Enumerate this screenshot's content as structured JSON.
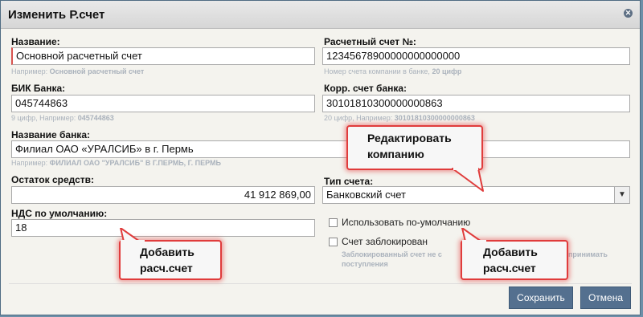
{
  "dialog": {
    "title": "Изменить Р.счет",
    "close_icon": "close-icon"
  },
  "left": {
    "name_label": "Название:",
    "name_value": "Основной расчетный счет",
    "name_hint_prefix": "Например:",
    "name_hint_example": "Основной расчетный счет",
    "bik_label": "БИК Банка:",
    "bik_value": "045744863",
    "bik_hint_prefix": "9 цифр, Например:",
    "bik_hint_example": "045744863",
    "bank_label": "Название банка:",
    "bank_value": "Филиал ОАО «УРАЛСИБ» в г. Пермь",
    "bank_hint_prefix": "Например:",
    "bank_hint_example": "ФИЛИАЛ ОАО \"УРАЛСИБ\" В Г.ПЕРМЬ, Г. ПЕРМЬ",
    "balance_label": "Остаток средств:",
    "balance_value": "41 912 869,00",
    "vat_label": "НДС по умолчанию:",
    "vat_value": "18"
  },
  "right": {
    "account_label": "Расчетный счет №:",
    "account_value": "12345678900000000000000",
    "account_hint_prefix": "Номер счета компании в банке,",
    "account_hint_example": "20 цифр",
    "corr_label": "Корр. счет банка:",
    "corr_value": "30101810300000000863",
    "corr_hint_prefix": "20 цифр, Например:",
    "corr_hint_example": "30101810300000000863",
    "type_label": "Тип счета:",
    "type_value": "Банковский счет",
    "default_checkbox": "Использовать по-умолчанию",
    "blocked_checkbox": "Счет заблокирован",
    "blocked_hint_line1": "Заблокированный счет не с",
    "blocked_hint_line1_tail": "принимать",
    "blocked_hint_line2": "поступления"
  },
  "buttons": {
    "save": "Сохранить",
    "cancel": "Отмена"
  },
  "callouts": {
    "edit_company_line1": "Редактировать",
    "edit_company_line2": "компанию",
    "add_account_left_line1": "Добавить",
    "add_account_left_line2": "расч.счет",
    "add_account_right_line1": "Добавить",
    "add_account_right_line2": "расч.счет"
  },
  "colors": {
    "accent": "#54708f",
    "callout_border": "#e03c3c",
    "backdrop": "#6d8fa8"
  }
}
